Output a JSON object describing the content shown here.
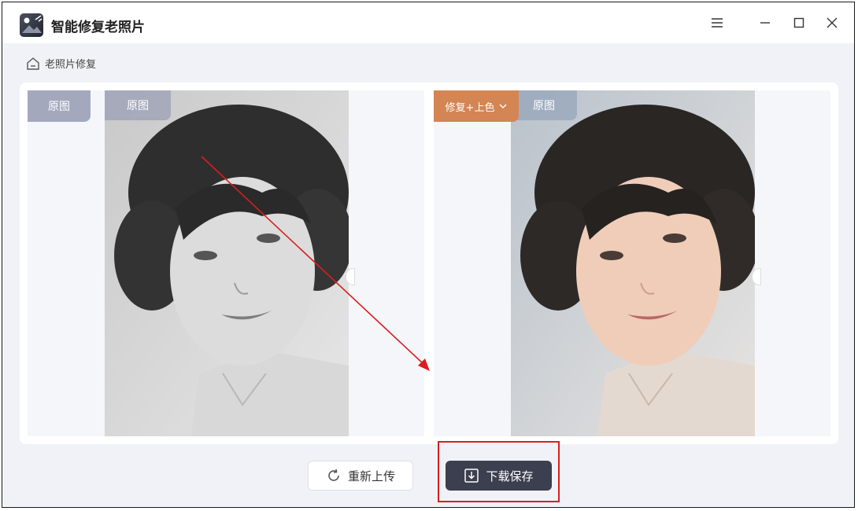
{
  "app": {
    "title": "智能修复老照片"
  },
  "breadcrumb": {
    "label": "老照片修复"
  },
  "left_panel": {
    "badge": "原图",
    "image_badge": "原图"
  },
  "right_panel": {
    "mode_select": "修复+上色",
    "image_badge": "原图"
  },
  "actions": {
    "reupload": "重新上传",
    "download": "下载保存"
  },
  "colors": {
    "accent": "#d48554",
    "download_bg": "#3b3f4f",
    "highlight": "#d81e1e",
    "arrow": "#d81e1e"
  }
}
